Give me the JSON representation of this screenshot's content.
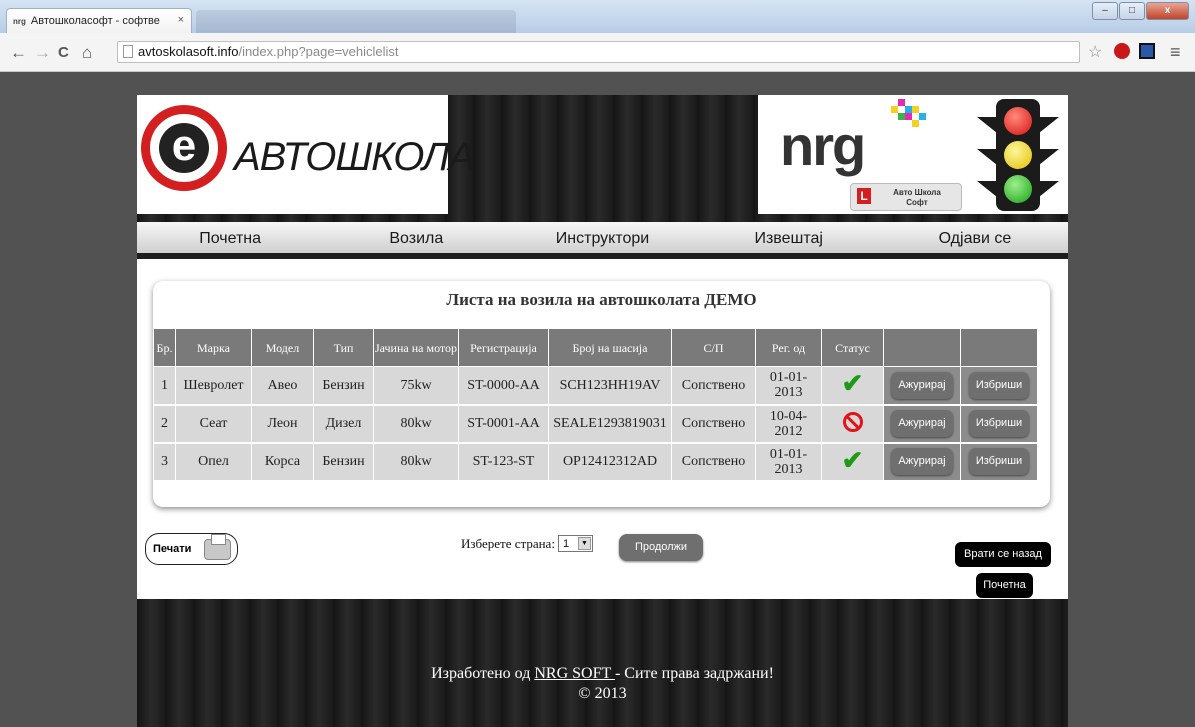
{
  "browser": {
    "tab_title": "Автошколасофт - софтве",
    "favicon_text": "nrg",
    "tab_close": "×",
    "url_host": "avtoskolasoft.info",
    "url_path": "/index.php?page=vehiclelist",
    "back": "←",
    "forward": "→",
    "reload": "C",
    "home": "⌂",
    "star": "☆",
    "menu": "≡"
  },
  "header": {
    "logo_letter": "e",
    "logo_text": "АВТОШКОЛА",
    "nrg_text": "nrg",
    "badge_text": "Авто Школа Софт",
    "badge_sign": "L"
  },
  "menu": {
    "items": [
      "Почетна",
      "Возила",
      "Инструктори",
      "Извештај",
      "Одјави се"
    ]
  },
  "panel": {
    "title": "Листа на возила на автошколата ДЕМО"
  },
  "table": {
    "headers": [
      "Бр.",
      "Марка",
      "Модел",
      "Тип",
      "Јачина на мотор",
      "Регистрација",
      "Број на шасија",
      "С/П",
      "Рег. од",
      "Статус"
    ],
    "rows": [
      {
        "no": "1",
        "make": "Шевролет",
        "model": "Авео",
        "type": "Бензин",
        "power": "75kw",
        "reg": "ST-0000-AA",
        "chassis": "SCH123HH19AV",
        "sp": "Сопствено",
        "reg_from": "01-01-2013",
        "status": "active"
      },
      {
        "no": "2",
        "make": "Сеат",
        "model": "Леон",
        "type": "Дизел",
        "power": "80kw",
        "reg": "ST-0001-AA",
        "chassis": "SEALE1293819031",
        "sp": "Сопствено",
        "reg_from": "10-04-2012",
        "status": "inactive"
      },
      {
        "no": "3",
        "make": "Опел",
        "model": "Корса",
        "type": "Бензин",
        "power": "80kw",
        "reg": "ST-123-ST",
        "chassis": "OP12412312AD",
        "sp": "Сопствено",
        "reg_from": "01-01-2013",
        "status": "active"
      }
    ],
    "update_label": "Ажурирај",
    "delete_label": "Избриши"
  },
  "controls": {
    "print_label": "Печати",
    "pager_label": "Изберете страна:",
    "page_value": "1",
    "continue_label": "Продолжи",
    "back_label": "Врати се назад",
    "home_label": "Почетна"
  },
  "footer": {
    "prefix": "Изработено од ",
    "link": "NRG SOFT ",
    "suffix": "- Сите права задржани!",
    "copyright": "© 2013"
  },
  "colors": {
    "status_ok": "#1e9a17",
    "status_blocked": "#e0141a",
    "table_header": "#7a7a7a",
    "table_cell": "#d8d8d8"
  }
}
